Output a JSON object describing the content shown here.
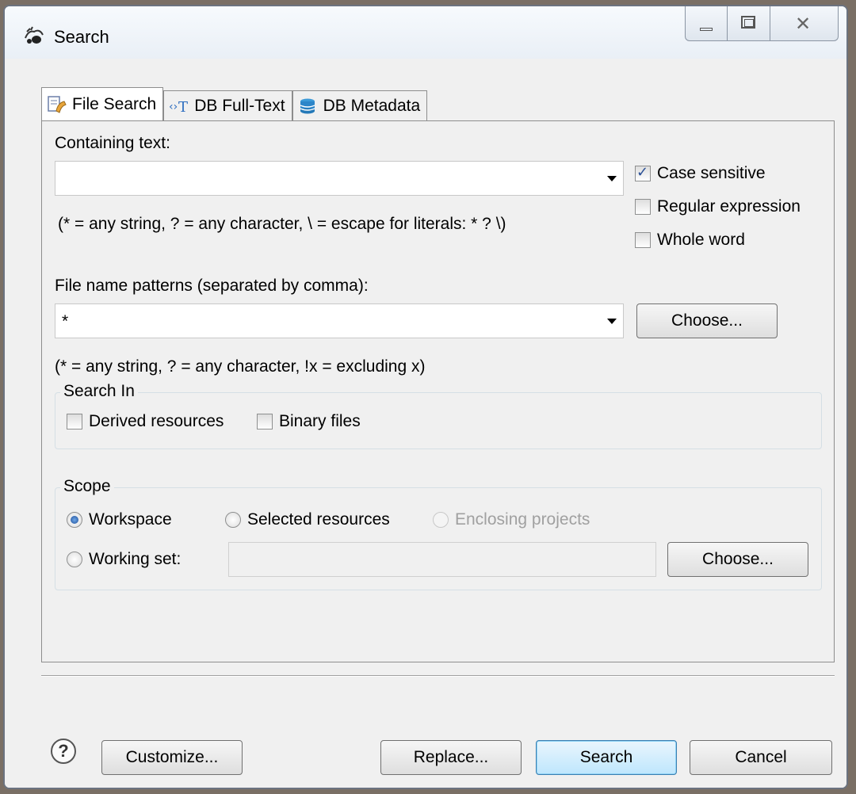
{
  "window": {
    "title": "Search"
  },
  "tabs": [
    {
      "label": "File Search",
      "icon": "file-search-icon",
      "active": true
    },
    {
      "label": "DB Full-Text",
      "icon": "db-fulltext-icon",
      "active": false
    },
    {
      "label": "DB Metadata",
      "icon": "db-metadata-icon",
      "active": false
    }
  ],
  "containing": {
    "label": "Containing text:",
    "value": "",
    "hint": "(* = any string, ? = any character, \\ = escape for literals: * ? \\)"
  },
  "options": {
    "case_sensitive": {
      "label": "Case sensitive",
      "checked": true
    },
    "regex": {
      "label": "Regular expression",
      "checked": false
    },
    "whole_word": {
      "label": "Whole word",
      "checked": false
    }
  },
  "patterns": {
    "label": "File name patterns (separated by comma):",
    "value": "*",
    "choose": "Choose...",
    "hint": "(* = any string, ? = any character, !x = excluding x)"
  },
  "search_in": {
    "title": "Search In",
    "derived": {
      "label": "Derived resources",
      "checked": false
    },
    "binary": {
      "label": "Binary files",
      "checked": false
    }
  },
  "scope": {
    "title": "Scope",
    "workspace": "Workspace",
    "selected": "Selected resources",
    "enclosing": "Enclosing projects",
    "working_set": "Working set:",
    "working_set_value": "",
    "choose": "Choose...",
    "selected_option": "Workspace"
  },
  "footer": {
    "help": "?",
    "customize": "Customize...",
    "replace": "Replace...",
    "search": "Search",
    "cancel": "Cancel"
  }
}
